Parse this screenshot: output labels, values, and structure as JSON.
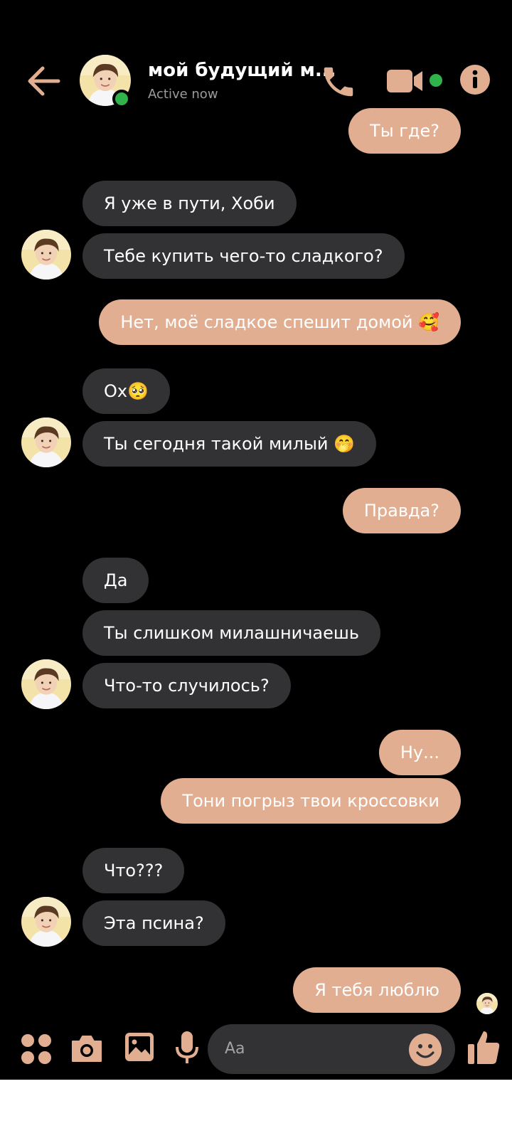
{
  "header": {
    "contact_name": "мой будущий м...",
    "status": "Active now"
  },
  "colors": {
    "accent": "#e2ae92",
    "incoming_bubble": "#323234",
    "online": "#2fb34a",
    "background": "#000000"
  },
  "icons": [
    "back-arrow-icon",
    "phone-icon",
    "video-camera-icon",
    "info-icon",
    "apps-grid-icon",
    "camera-icon",
    "gallery-icon",
    "microphone-icon",
    "smiley-icon",
    "thumbs-up-icon"
  ],
  "messages": [
    {
      "dir": "out",
      "text": "Ты где?"
    },
    {
      "dir": "in",
      "text": "Я уже в пути, Хоби"
    },
    {
      "dir": "in",
      "text": "Тебе купить чего-то сладкого?"
    },
    {
      "dir": "out",
      "text": "Нет, моё сладкое спешит домой 🥰"
    },
    {
      "dir": "in",
      "text": "Ох🥺"
    },
    {
      "dir": "in",
      "text": "Ты сегодня такой милый 🤭"
    },
    {
      "dir": "out",
      "text": "Правда?"
    },
    {
      "dir": "in",
      "text": "Да"
    },
    {
      "dir": "in",
      "text": "Ты слишком милашничаешь"
    },
    {
      "dir": "in",
      "text": "Что-то случилось?"
    },
    {
      "dir": "out",
      "text": "Ну..."
    },
    {
      "dir": "out",
      "text": "Тони погрыз твои кроссовки"
    },
    {
      "dir": "in",
      "text": "Что???"
    },
    {
      "dir": "in",
      "text": "Эта псина?"
    },
    {
      "dir": "out",
      "text": "Я тебя люблю"
    }
  ],
  "composer": {
    "placeholder": "Aa"
  }
}
